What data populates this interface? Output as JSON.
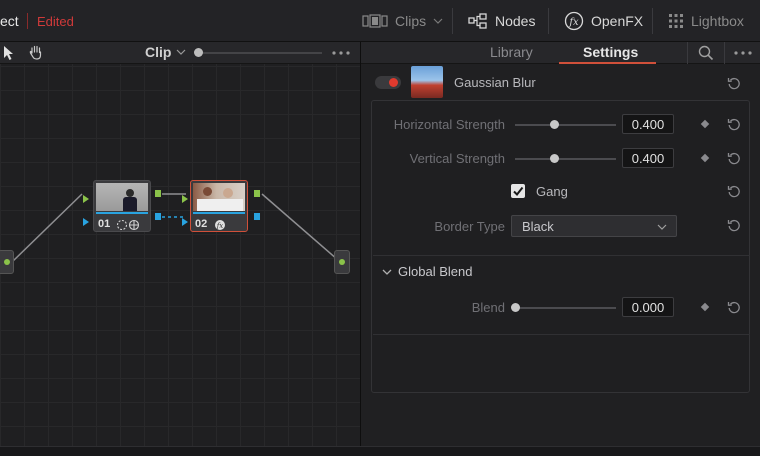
{
  "topbar": {
    "project_title": "ect",
    "status": "Edited",
    "clips_label": "Clips",
    "nodes_label": "Nodes",
    "openfx_label": "OpenFX",
    "lightbox_label": "Lightbox"
  },
  "node_editor": {
    "mode_label": "Clip",
    "nodes": [
      {
        "number": "01"
      },
      {
        "number": "02"
      }
    ]
  },
  "inspector": {
    "tabs": [
      "Library",
      "Settings"
    ],
    "active_tab": "Settings",
    "effect_name": "Gaussian Blur",
    "params": {
      "horizontal_label": "Horizontal Strength",
      "horizontal_value": "0.400",
      "vertical_label": "Vertical Strength",
      "vertical_value": "0.400",
      "gang_label": "Gang",
      "border_label": "Border Type",
      "border_value": "Black"
    },
    "global_blend": {
      "section_label": "Global Blend",
      "blend_label": "Blend",
      "blend_value": "0.000"
    }
  },
  "colors": {
    "accent": "#d03a3a",
    "node_input": "#8bc34a",
    "node_blue": "#29a3e0"
  }
}
